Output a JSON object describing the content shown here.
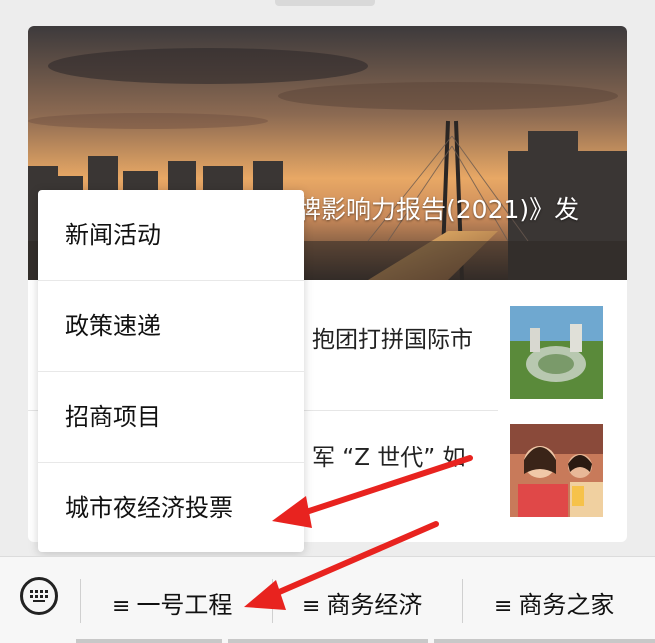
{
  "article_list": {
    "hero_title": "牌影响力报告(2021)》发",
    "items": [
      {
        "title": "抱团打拼国际市"
      },
      {
        "title": "军 “Z 世代” 如"
      }
    ]
  },
  "popup_menu": {
    "items": [
      {
        "label": "新闻活动"
      },
      {
        "label": "政策速递"
      },
      {
        "label": "招商项目"
      },
      {
        "label": "城市夜经济投票"
      }
    ]
  },
  "bottom_menu": {
    "keyboard_icon": "keyboard-icon",
    "tabs": [
      {
        "icon": "≡",
        "label": "一号工程"
      },
      {
        "icon": "≡",
        "label": "商务经济"
      },
      {
        "icon": "≡",
        "label": "商务之家"
      }
    ]
  },
  "annotation_color": "#e8231f"
}
